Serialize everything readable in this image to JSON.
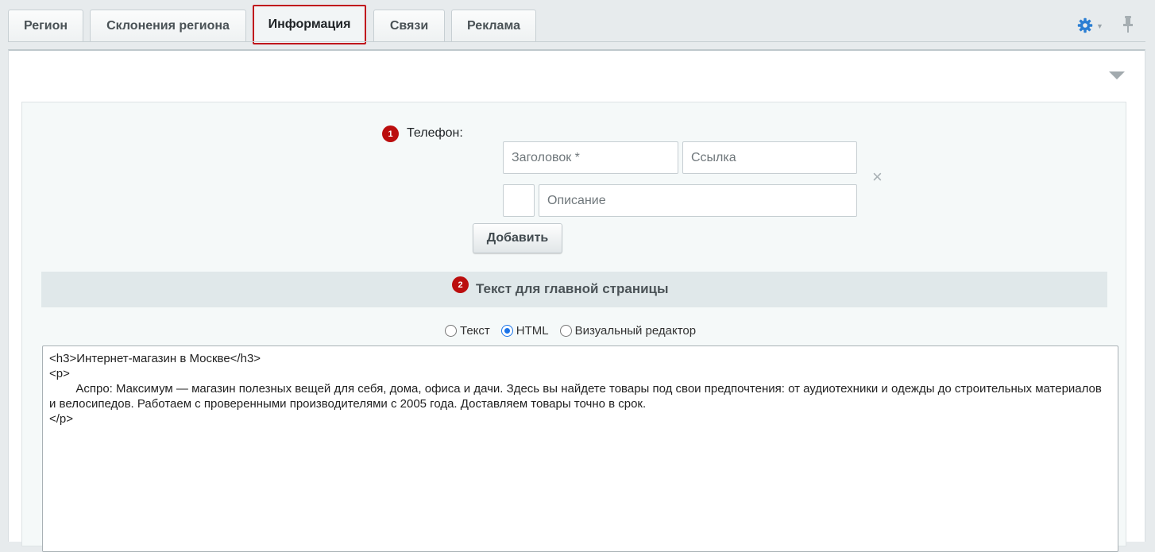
{
  "tabs": [
    {
      "label": "Регион"
    },
    {
      "label": "Склонения региона"
    },
    {
      "label": "Информация"
    },
    {
      "label": "Связи"
    },
    {
      "label": "Реклама"
    }
  ],
  "active_tab": "Информация",
  "icons": {
    "settings": "gear-icon",
    "pin": "pin-icon",
    "collapse": "triangle-down-icon",
    "remove": "close-icon"
  },
  "colors": {
    "accent": "#bb0e0e",
    "settings_icon": "#2a7ed3",
    "radio_checked": "#1a73e8"
  },
  "phone": {
    "badge": "1",
    "label": "Телефон:",
    "title_placeholder": "Заголовок *",
    "link_placeholder": "Ссылка",
    "description_placeholder": "Описание",
    "remove_symbol": "×",
    "add_button": "Добавить"
  },
  "main_text": {
    "badge": "2",
    "heading": "Текст для главной страницы",
    "modes": [
      {
        "label": "Текст",
        "checked": false
      },
      {
        "label": "HTML",
        "checked": true
      },
      {
        "label": "Визуальный редактор",
        "checked": false
      }
    ],
    "content": "<h3>Интернет-магазин в Москве</h3>\n<p>\n\tАспро: Максимум — магазин полезных вещей для себя, дома, офиса и дачи. Здесь вы найдете товары под свои предпочтения: от аудиотехники и одежды до строительных материалов и велосипедов. Работаем с проверенными производителями с 2005 года. Доставляем товары точно в срок.\n</p>"
  }
}
